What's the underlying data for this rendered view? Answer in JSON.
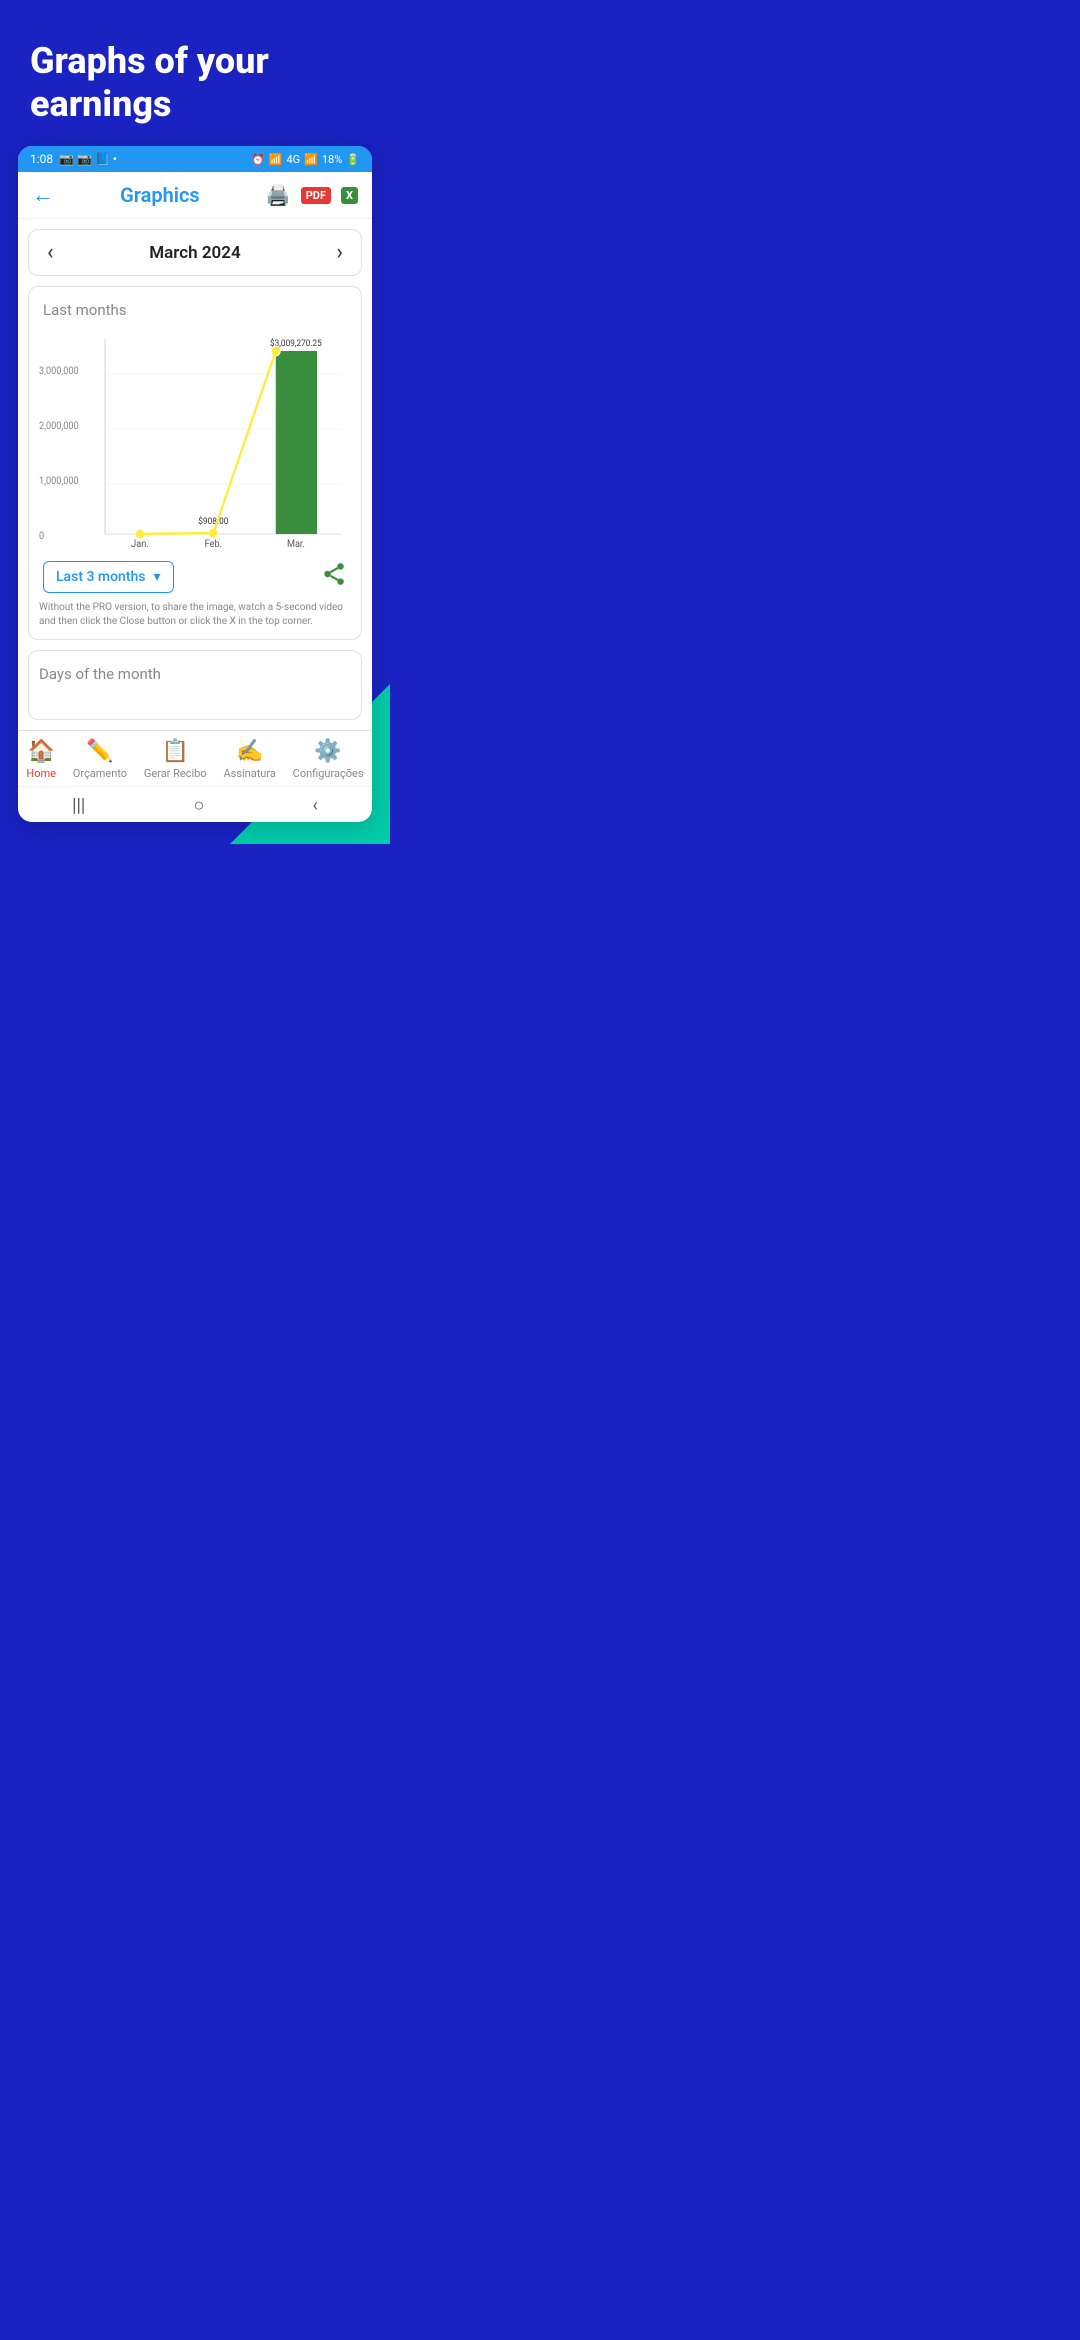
{
  "hero": {
    "heading": "Graphs of your earnings"
  },
  "status_bar": {
    "time": "1:08",
    "battery": "18%",
    "signal": "4G",
    "wifi": "WiFi"
  },
  "header": {
    "title": "Graphics",
    "back_label": "←",
    "print_icon": "🖨️",
    "pdf_icon": "PDF",
    "excel_icon": "X"
  },
  "month_nav": {
    "prev_arrow": "‹",
    "next_arrow": "›",
    "label": "March 2024"
  },
  "chart": {
    "title": "Last months",
    "y_labels": [
      "0",
      "1,000,000",
      "2,000,000",
      "3,000,000"
    ],
    "bars": [
      {
        "month": "Jan.",
        "value": 0,
        "display": ""
      },
      {
        "month": "Feb.",
        "value": 908,
        "display": "$908.00"
      },
      {
        "month": "Mar.",
        "value": 3009270.25,
        "display": "$3,009,270.25"
      }
    ],
    "max_value": 3200000
  },
  "period_selector": {
    "label": "Last 3 months",
    "dropdown_icon": "▾"
  },
  "pro_notice": "Without the PRO version, to share the image, watch a 5-second video and then click the Close button or click the X in the top corner.",
  "days_section": {
    "title": "Days of the month"
  },
  "bottom_nav": {
    "items": [
      {
        "id": "home",
        "label": "Home",
        "icon": "🏠",
        "active": true
      },
      {
        "id": "orcamento",
        "label": "Orçamento",
        "icon": "✏️",
        "active": false
      },
      {
        "id": "gerar_recibo",
        "label": "Gerar Recibo",
        "icon": "📄",
        "active": false
      },
      {
        "id": "assinatura",
        "label": "Assinatura",
        "icon": "✍️",
        "active": false
      },
      {
        "id": "configuracoes",
        "label": "Configurações",
        "icon": "⚙️",
        "active": false
      }
    ]
  },
  "sys_nav": {
    "menu_icon": "|||",
    "home_icon": "○",
    "back_icon": "‹"
  },
  "colors": {
    "blue_bg": "#1a22c2",
    "accent_blue": "#2196f3",
    "green_bar": "#388e3c",
    "yellow_line": "#ffeb3b",
    "teal": "#00cba9"
  }
}
